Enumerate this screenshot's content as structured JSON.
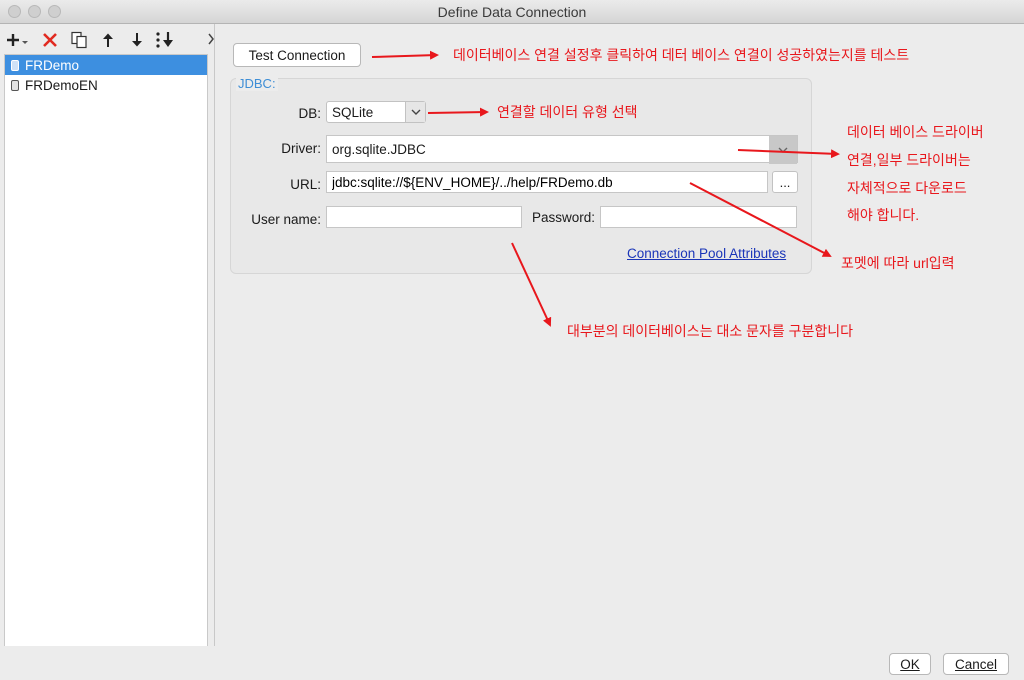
{
  "window": {
    "title": "Define Data Connection"
  },
  "toolbar": {
    "add_label": "+",
    "items": [
      "add-icon",
      "delete-icon",
      "copy-icon",
      "move-up-icon",
      "move-down-icon",
      "sort-icon"
    ]
  },
  "connections": [
    {
      "name": "FRDemo",
      "selected": true
    },
    {
      "name": "FRDemoEN",
      "selected": false
    }
  ],
  "form": {
    "test_button": "Test Connection",
    "group_label": "JDBC:",
    "db_label": "DB:",
    "db_value": "SQLite",
    "driver_label": "Driver:",
    "driver_value": "org.sqlite.JDBC",
    "url_label": "URL:",
    "url_value": "jdbc:sqlite://${ENV_HOME}/../help/FRDemo.db",
    "url_button": "...",
    "username_label": "User name:",
    "username_value": "",
    "password_label": "Password:",
    "password_value": "",
    "pool_link": "Connection Pool Attributes"
  },
  "annotations": {
    "test": "데이터베이스 연결 설정후 클릭하여 데터 베이스 연결이 성공하였는지를 테스트",
    "db_type": "연결할 데이터 유형 선택",
    "driver_line1": "데이터 베이스 드라이버",
    "driver_line2": "연결,일부 드라이버는",
    "driver_line3": "자체적으로 다운로드",
    "driver_line4": "해야 합니다.",
    "url": "포멧에 따라 url입력",
    "case": "대부분의 데이터베이스는 대소 문자를 구분합니다"
  },
  "buttons": {
    "ok": "OK",
    "cancel": "Cancel"
  },
  "colors": {
    "selection": "#3d8fe0",
    "annotation": "#e8171c",
    "link": "#1a35b8",
    "group_label": "#3e8ed6"
  }
}
